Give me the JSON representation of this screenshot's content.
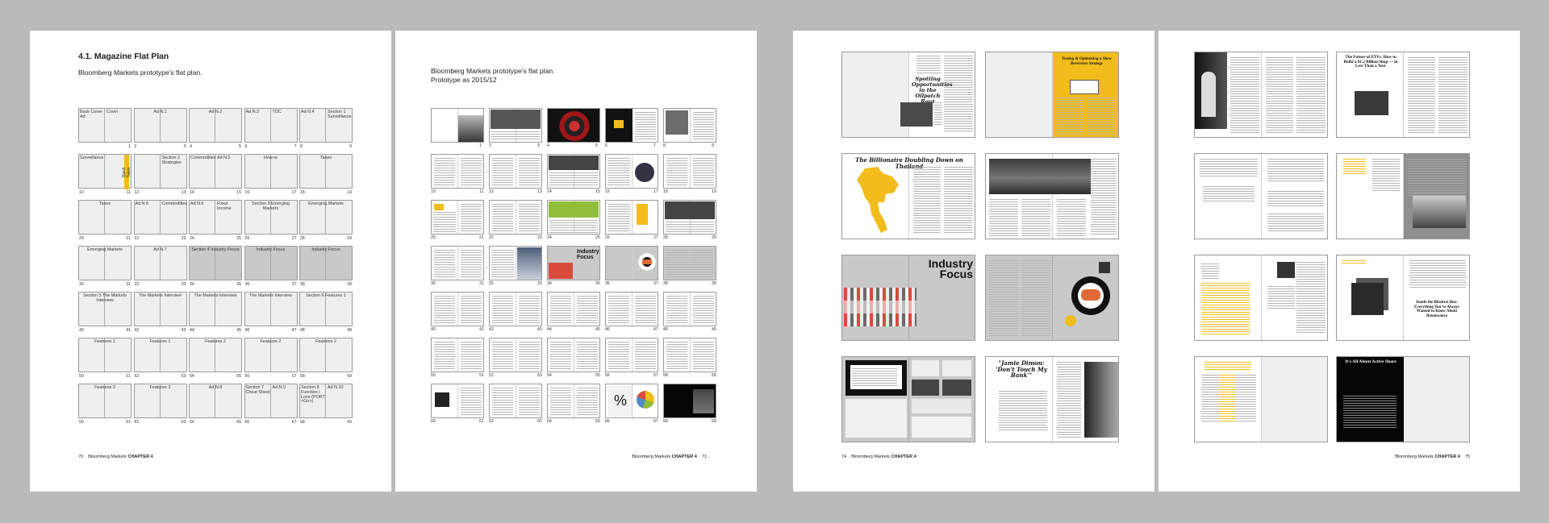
{
  "page1": {
    "title": "4.1. Magazine Flat Plan",
    "subtitle": "Bloomberg Markets prototype's flat plan.",
    "footer_num": "70",
    "footer_brand": "Bloomberg Markets",
    "footer_chapter": "CHAPTER 4",
    "spreads": [
      {
        "l": "Back Cover Ad",
        "r": "Cover",
        "nl": "",
        "nr": "1"
      },
      {
        "c": "Ad N.1",
        "nl": "2",
        "nr": "3"
      },
      {
        "c": "Ad N.2",
        "nl": "4",
        "nr": "5"
      },
      {
        "l": "Ad N.3",
        "r": "TOC",
        "nl": "6",
        "nr": "7"
      },
      {
        "l": "Ad N.4",
        "r": "Section 1 Surveillance",
        "nl": "8",
        "nr": "9"
      },
      {
        "l": "Surveillance",
        "r": "",
        "quick": "Quick Takes",
        "nl": "10",
        "nr": "11"
      },
      {
        "l": "",
        "r": "Section 2 Strategies",
        "nl": "12",
        "nr": "13"
      },
      {
        "l": "Commodities",
        "r": "Ad N.5",
        "nl": "14",
        "nr": "15"
      },
      {
        "c": "How-to",
        "nl": "16",
        "nr": "17"
      },
      {
        "c": "Taxes",
        "nl": "18",
        "nr": "19"
      },
      {
        "c": "Taxes",
        "nl": "20",
        "nr": "21"
      },
      {
        "l": "Ad N.6",
        "r": "Commodities",
        "nl": "22",
        "nr": "23"
      },
      {
        "l": "Ad N.6",
        "r": "Fixed Income",
        "nl": "24",
        "nr": "25"
      },
      {
        "c": "Section 3 Emerging Markets",
        "nl": "26",
        "nr": "27"
      },
      {
        "c": "Emerging Markets",
        "nl": "28",
        "nr": "29"
      },
      {
        "c": "Emerging Markets",
        "nl": "30",
        "nr": "31"
      },
      {
        "c": "Ad N.7",
        "nl": "32",
        "nr": "33"
      },
      {
        "c": "Section 4 Industry Focus",
        "gray": true,
        "nl": "34",
        "nr": "35"
      },
      {
        "c": "Industry Focus",
        "gray": true,
        "nl": "36",
        "nr": "37"
      },
      {
        "c": "Industry Focus",
        "gray": true,
        "nl": "38",
        "nr": "39"
      },
      {
        "c": "Section 5 The Markets Interview",
        "nl": "40",
        "nr": "41"
      },
      {
        "c": "The Markets Interview",
        "nl": "42",
        "nr": "43"
      },
      {
        "c": "The Markets Interview",
        "nl": "44",
        "nr": "45"
      },
      {
        "c": "The Markets Interview",
        "nl": "46",
        "nr": "47"
      },
      {
        "c": "Section 6 Features 1",
        "nl": "48",
        "nr": "49"
      },
      {
        "c": "Features 1",
        "nl": "50",
        "nr": "51"
      },
      {
        "c": "Features 1",
        "nl": "52",
        "nr": "53"
      },
      {
        "c": "Features 2",
        "nl": "54",
        "nr": "55"
      },
      {
        "c": "Features 2",
        "nl": "56",
        "nr": "57"
      },
      {
        "c": "Features 2",
        "nl": "58",
        "nr": "59"
      },
      {
        "c": "Features 3",
        "nl": "60",
        "nr": "61"
      },
      {
        "c": "Features 3",
        "nl": "62",
        "nr": "63"
      },
      {
        "c": "Ad N.8",
        "nl": "64",
        "nr": "65"
      },
      {
        "l": "Section 7 Cheat Sheet",
        "r": "Ad N.9",
        "nl": "66",
        "nr": "67"
      },
      {
        "l": "Section 8 Function I Love (PORT <Go>)",
        "r": "Ad N.10",
        "nl": "68",
        "nr": "69"
      }
    ]
  },
  "page2": {
    "subtitle_line1": "Bloomberg Markets prototype's flat plan.",
    "subtitle_line2": "Prototype as 2015/12",
    "footer_brand": "Bloomberg Markets",
    "footer_chapter": "CHAPTER 4",
    "footer_num": "71",
    "thumb_text": {
      "industry": "Industry Focus",
      "percent": "%"
    },
    "numbers": [
      [
        "",
        "1"
      ],
      [
        "2",
        "3"
      ],
      [
        "4",
        "5"
      ],
      [
        "6",
        "7"
      ],
      [
        "8",
        "9"
      ],
      [
        "10",
        "11"
      ],
      [
        "12",
        "13"
      ],
      [
        "14",
        "15"
      ],
      [
        "16",
        "17"
      ],
      [
        "18",
        "19"
      ],
      [
        "20",
        "21"
      ],
      [
        "22",
        "23"
      ],
      [
        "24",
        "25"
      ],
      [
        "26",
        "27"
      ],
      [
        "28",
        "29"
      ],
      [
        "30",
        "31"
      ],
      [
        "32",
        "33"
      ],
      [
        "34",
        "35"
      ],
      [
        "36",
        "37"
      ],
      [
        "38",
        "39"
      ],
      [
        "40",
        "41"
      ],
      [
        "42",
        "43"
      ],
      [
        "44",
        "45"
      ],
      [
        "46",
        "47"
      ],
      [
        "48",
        "49"
      ],
      [
        "50",
        "51"
      ],
      [
        "52",
        "53"
      ],
      [
        "54",
        "55"
      ],
      [
        "56",
        "57"
      ],
      [
        "58",
        "59"
      ],
      [
        "60",
        "61"
      ],
      [
        "62",
        "63"
      ],
      [
        "64",
        "65"
      ],
      [
        "66",
        "67"
      ],
      [
        "68",
        "69"
      ]
    ]
  },
  "page3": {
    "footer_num": "74",
    "footer_brand": "Bloomberg Markets",
    "footer_chapter": "CHAPTER 4",
    "headlines": {
      "spotting": "Spotting Opportunities in the Oilpatch Rout",
      "testing": "Testing & Optimizing a Skew Reversion Strategy",
      "thailand": "The Billionaire Doubling Down on Thailand",
      "industry": "Industry Focus",
      "dimon": "\"Jamie Dimon: 'Don't Touch My Bank'\""
    }
  },
  "page4": {
    "footer_brand": "Bloomberg Markets",
    "footer_chapter": "CHAPTER 4",
    "footer_num": "75",
    "headlines": {
      "etf": "The Future of ETFs: How to Build a $1.2 Billion Shop — in Less Than a Year",
      "renaissance": "Inside the Blackest Box: Everything You've Always Wanted to Know About Renaissance",
      "active": "It's All About Active Share"
    }
  },
  "colors": {
    "accent_yellow": "#f2bd1c",
    "gray_section": "#c9c9c9",
    "page_bg": "#b9babb"
  }
}
